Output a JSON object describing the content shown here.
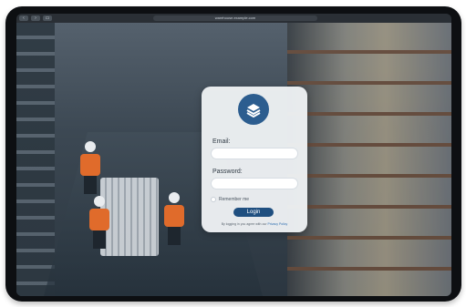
{
  "browser": {
    "back_label": "‹",
    "forward_label": "›",
    "sidebar_label": "▭",
    "url": "warehouse.example.com"
  },
  "login": {
    "email_label": "Email:",
    "email_value": "",
    "password_label": "Password:",
    "password_value": "",
    "remember_label": "Remember me",
    "login_button": "Login",
    "terms_text": "By logging in you agree with our",
    "terms_link": "Privacy Policy"
  },
  "colors": {
    "accent": "#1f4f80",
    "logo": "#2c5d8f",
    "card": "#eef1f4"
  },
  "icons": {
    "logo": "stacked-layers-icon"
  }
}
